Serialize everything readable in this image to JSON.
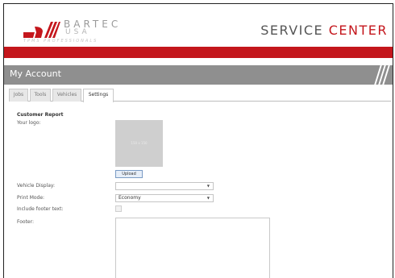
{
  "brand": {
    "name": "BARTEC",
    "sub": "USA",
    "tagline": "TPMS PROFESSIONALS",
    "accent": "#c4161c"
  },
  "header": {
    "service": "SERVICE",
    "center": "CENTER"
  },
  "page": {
    "title": "My Account"
  },
  "tabs": [
    {
      "label": "Jobs",
      "active": false
    },
    {
      "label": "Tools",
      "active": false
    },
    {
      "label": "Vehicles",
      "active": false
    },
    {
      "label": "Settings",
      "active": true
    }
  ],
  "form": {
    "section_title": "Customer Report",
    "logo_label": "Your logo:",
    "logo_placeholder": "150 x 150",
    "upload_label": "Upload",
    "vehicle_display_label": "Vehicle Display:",
    "vehicle_display_value": "",
    "print_mode_label": "Print Mode:",
    "print_mode_value": "Economy",
    "include_footer_label": "Include footer text:",
    "include_footer_checked": false,
    "footer_label": "Footer:",
    "footer_value": ""
  }
}
